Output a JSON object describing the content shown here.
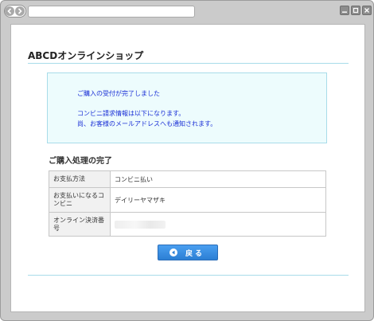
{
  "browser": {
    "url": "",
    "icons": {
      "back": "back-arrow-icon",
      "forward": "forward-arrow-icon",
      "minimize": "minimize-icon",
      "maximize": "maximize-icon",
      "close": "close-icon"
    }
  },
  "page": {
    "shop_title": "ABCDオンラインショップ",
    "notice": {
      "line1": "ご購入の受付が完了しました",
      "line2": "コンビニ請求情報は以下になります。",
      "line3": "尚、お客様のメールアドレスへも通知されます。"
    },
    "section_title": "ご購入処理の完了",
    "table": {
      "rows": [
        {
          "label": "お支払方法",
          "value": "コンビニ払い"
        },
        {
          "label": "お支払いになるコンビニ",
          "value": "デイリーヤマザキ"
        },
        {
          "label": "オンライン決済番号",
          "value": ""
        }
      ]
    },
    "back_button": {
      "label": "戻る",
      "icon": "left-arrow-circle-icon"
    }
  },
  "colors": {
    "accent_rule": "#a8dce9",
    "notice_bg": "#edfcfd",
    "notice_text": "#1a2fd6",
    "button_blue": "#2c7fd4"
  }
}
